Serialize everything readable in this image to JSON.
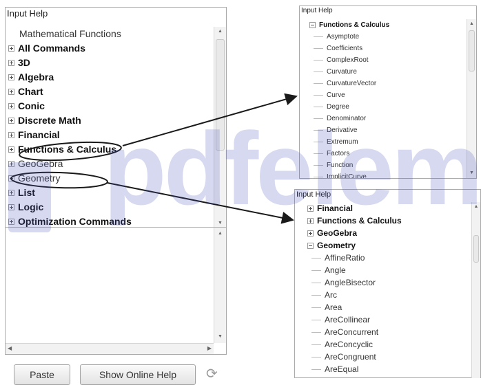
{
  "left_panel": {
    "title": "Input Help",
    "root_label": "Mathematical Functions",
    "items": [
      {
        "label": "All Commands",
        "bold": true
      },
      {
        "label": "3D",
        "bold": true
      },
      {
        "label": "Algebra",
        "bold": true
      },
      {
        "label": "Chart",
        "bold": true
      },
      {
        "label": "Conic",
        "bold": true
      },
      {
        "label": "Discrete Math",
        "bold": true
      },
      {
        "label": "Financial",
        "bold": true
      },
      {
        "label": "Functions & Calculus",
        "bold": true
      },
      {
        "label": "GeoGebra",
        "bold": false
      },
      {
        "label": "Geometry",
        "bold": false
      },
      {
        "label": "List",
        "bold": true
      },
      {
        "label": "Logic",
        "bold": true
      },
      {
        "label": "Optimization Commands",
        "bold": true
      }
    ],
    "buttons": {
      "paste": "Paste",
      "show_online_help": "Show Online Help"
    }
  },
  "top_right_panel": {
    "title": "Input Help",
    "category": "Functions & Calculus",
    "commands": [
      "Asymptote",
      "Coefficients",
      "ComplexRoot",
      "Curvature",
      "CurvatureVector",
      "Curve",
      "Degree",
      "Denominator",
      "Derivative",
      "Extremum",
      "Factors",
      "Function",
      "ImplicitCurve"
    ]
  },
  "bottom_right_panel": {
    "title": "Input Help",
    "collapsed": [
      "Financial",
      "Functions & Calculus",
      "GeoGebra"
    ],
    "expanded": "Geometry",
    "commands": [
      "AffineRatio",
      "Angle",
      "AngleBisector",
      "Arc",
      "Area",
      "AreCollinear",
      "AreConcurrent",
      "AreConcyclic",
      "AreCongruent",
      "AreEqual"
    ]
  },
  "watermark": {
    "text": "pdfelement"
  },
  "colors": {
    "annotation": "#1a1a1a",
    "watermark": "#4650b4",
    "panel_border": "#a9a9a9"
  }
}
